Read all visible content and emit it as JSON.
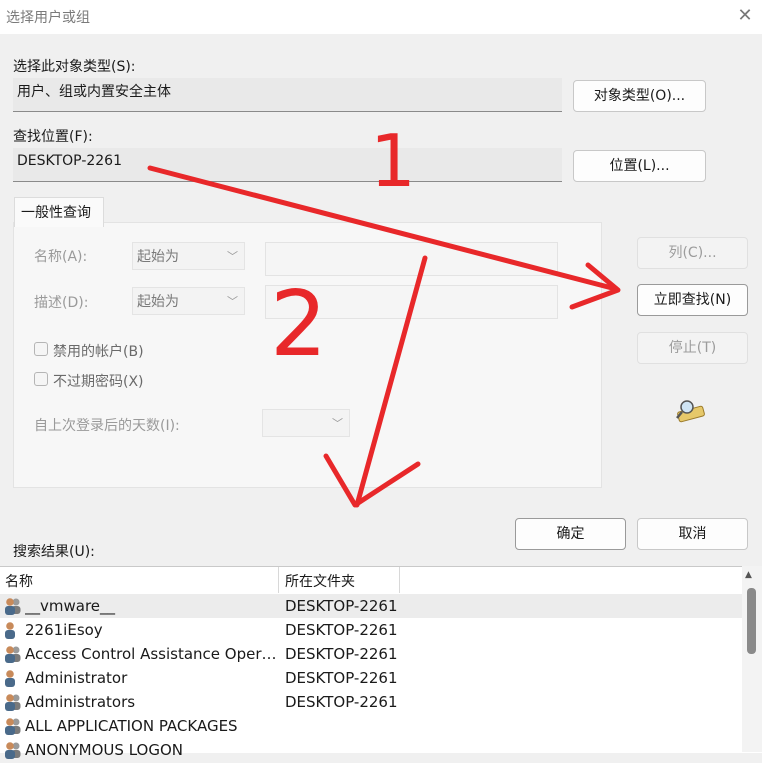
{
  "window": {
    "title": "选择用户或组"
  },
  "object_type": {
    "label": "选择此对象类型(S):",
    "value": "用户、组或内置安全主体",
    "button": "对象类型(O)..."
  },
  "location": {
    "label": "查找位置(F):",
    "value": "DESKTOP-2261",
    "button": "位置(L)..."
  },
  "general_query": {
    "tab": "一般性查询",
    "name_label": "名称(A):",
    "name_mode": "起始为",
    "desc_label": "描述(D):",
    "desc_mode": "起始为",
    "disabled_accounts": "禁用的帐户(B)",
    "non_expiring_pw": "不过期密码(X)",
    "days_since_login": "自上次登录后的天数(I):"
  },
  "side_buttons": {
    "columns": "列(C)...",
    "find_now": "立即查找(N)",
    "stop": "停止(T)"
  },
  "dialog_buttons": {
    "ok": "确定",
    "cancel": "取消"
  },
  "results": {
    "label": "搜索结果(U):",
    "col_name": "名称",
    "col_folder": "所在文件夹",
    "rows": [
      {
        "name": "__vmware__",
        "folder": "DESKTOP-2261",
        "icon": "group-icon"
      },
      {
        "name": "2261iEsoy",
        "folder": "DESKTOP-2261",
        "icon": "user-icon"
      },
      {
        "name": "Access Control Assistance Opera...",
        "folder": "DESKTOP-2261",
        "icon": "group-icon"
      },
      {
        "name": "Administrator",
        "folder": "DESKTOP-2261",
        "icon": "user-icon"
      },
      {
        "name": "Administrators",
        "folder": "DESKTOP-2261",
        "icon": "group-icon"
      },
      {
        "name": "ALL APPLICATION PACKAGES",
        "folder": "",
        "icon": "group-icon"
      },
      {
        "name": "ANONYMOUS LOGON",
        "folder": "",
        "icon": "group-icon"
      }
    ]
  },
  "annotations": {
    "mark_1": "1",
    "mark_2": "2",
    "color": "#e8282a"
  }
}
